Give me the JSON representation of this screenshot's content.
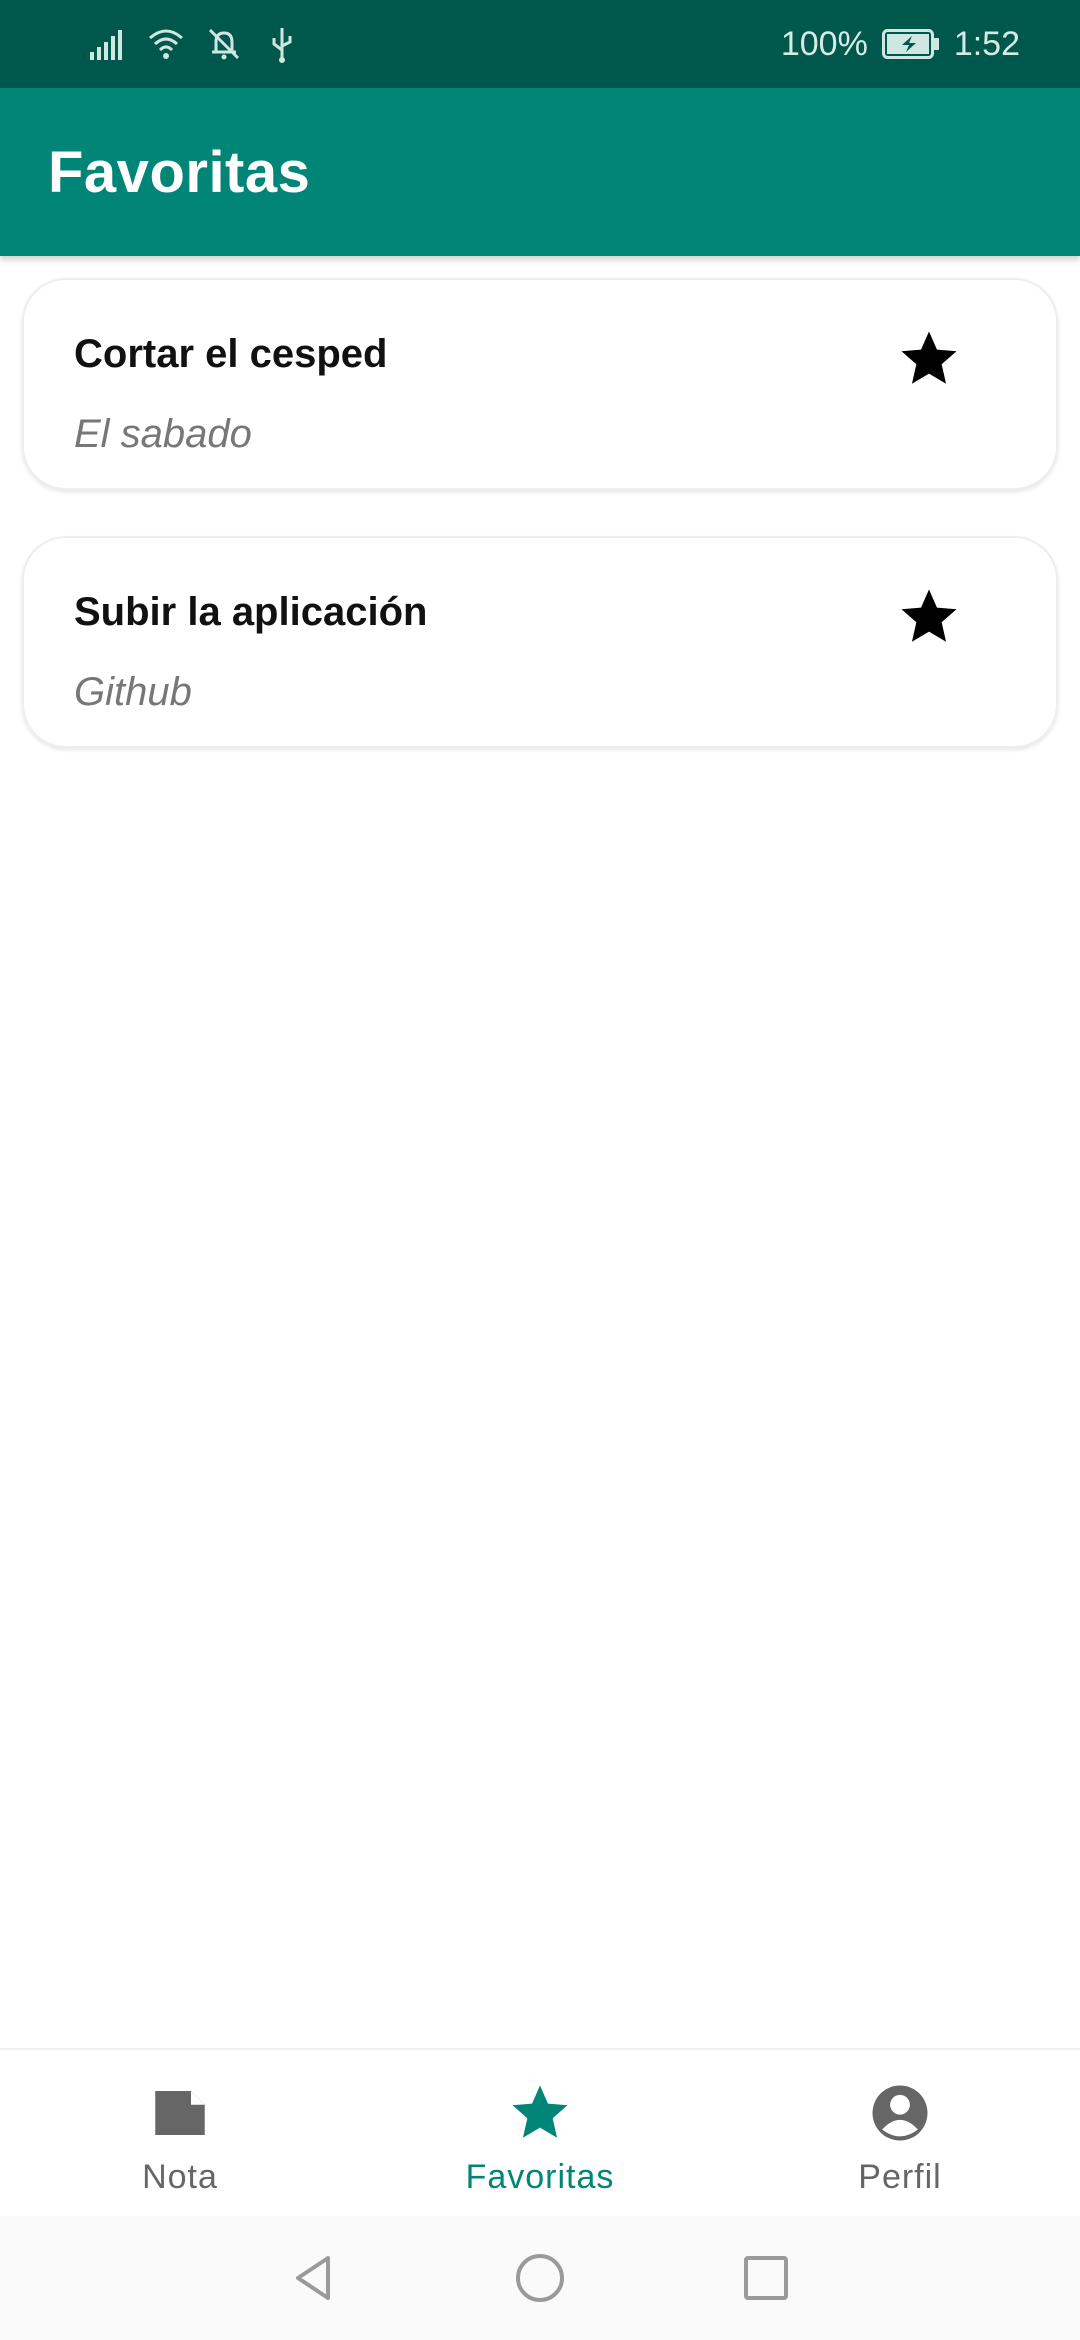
{
  "status_bar": {
    "battery_percent": "100%",
    "time": "1:52"
  },
  "app_bar": {
    "title": "Favoritas"
  },
  "favorites": [
    {
      "title": "Cortar el cesped",
      "subtitle": "El sabado",
      "icon": "star-icon"
    },
    {
      "title": "Subir la aplicación",
      "subtitle": "Github",
      "icon": "star-icon"
    }
  ],
  "bottom_nav": {
    "items": [
      {
        "label": "Nota",
        "icon": "note-icon",
        "active": false
      },
      {
        "label": "Favoritas",
        "icon": "star-icon",
        "active": true
      },
      {
        "label": "Perfil",
        "icon": "account-circle-icon",
        "active": false
      }
    ]
  },
  "colors": {
    "status_bar": "#00574B",
    "primary": "#008577",
    "inactive_icon": "#666666"
  }
}
